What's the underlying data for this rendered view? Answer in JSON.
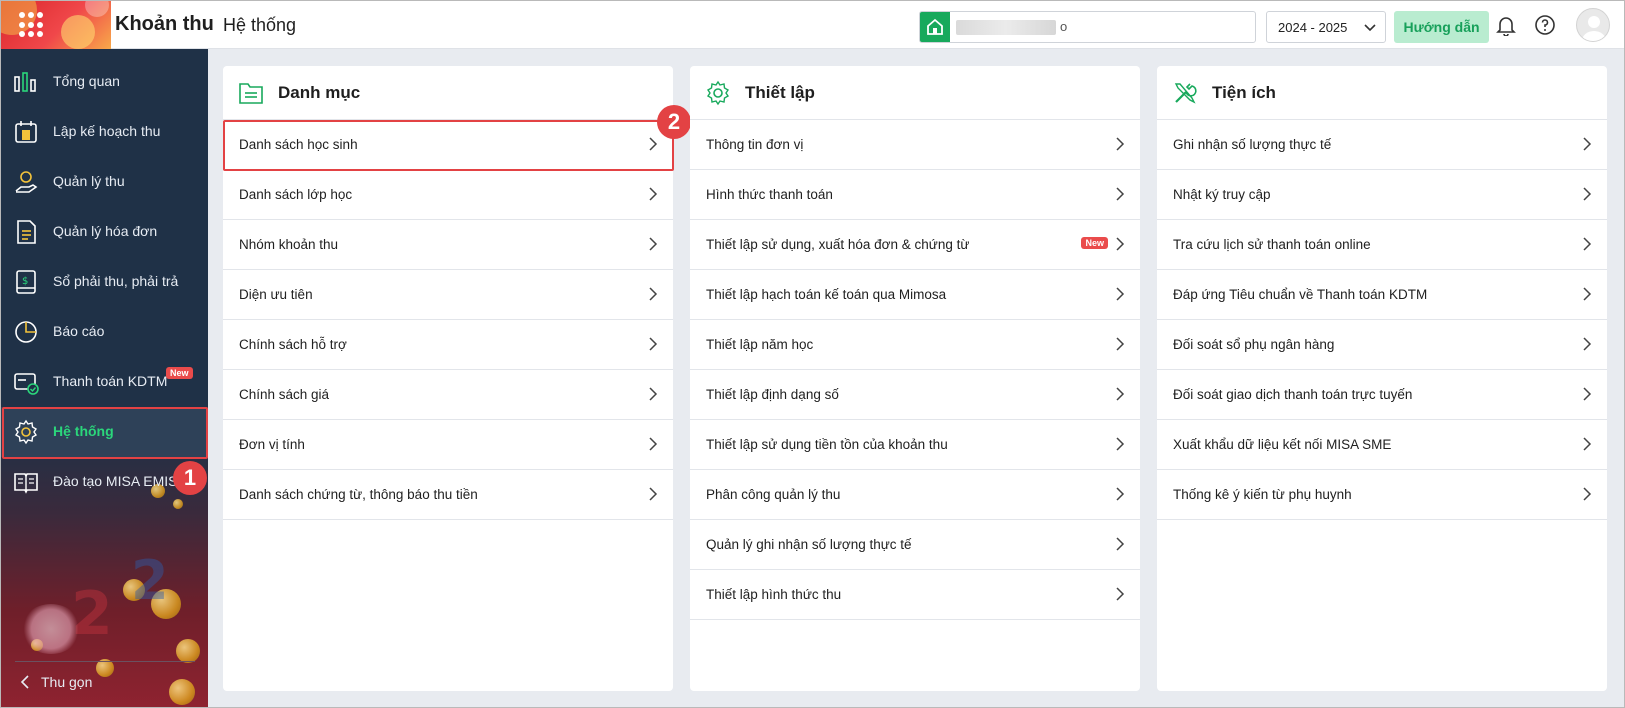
{
  "header": {
    "app_title": "Khoản thu",
    "page_title": "Hệ thống",
    "school_name_visible": "o",
    "school_year": "2024 - 2025",
    "guide_label": "Hướng dẫn",
    "brand_color": "#18a95c"
  },
  "sidebar": {
    "items": [
      {
        "label": "Tổng quan",
        "icon": "bar-chart-icon"
      },
      {
        "label": "Lập kế hoạch thu",
        "icon": "calendar-money-icon"
      },
      {
        "label": "Quản lý thu",
        "icon": "hand-coin-icon"
      },
      {
        "label": "Quản lý hóa đơn",
        "icon": "invoice-icon"
      },
      {
        "label": "Sổ phải thu, phải trả",
        "icon": "ledger-icon"
      },
      {
        "label": "Báo cáo",
        "icon": "pie-chart-icon"
      },
      {
        "label": "Thanh toán KDTM",
        "icon": "card-check-icon",
        "badge": "New"
      },
      {
        "label": "Hệ thống",
        "icon": "gear-icon",
        "active": true
      },
      {
        "label": "Đào tạo MISA EMIS",
        "icon": "book-icon"
      }
    ],
    "collapse_label": "Thu gọn",
    "active_color": "#2bd67b"
  },
  "annotations": {
    "step1": "1",
    "step2": "2",
    "color": "#e34244"
  },
  "cards": [
    {
      "title": "Danh mục",
      "icon": "folder-list-icon",
      "items": [
        {
          "label": "Danh sách học sinh"
        },
        {
          "label": "Danh sách lớp học"
        },
        {
          "label": "Nhóm khoản thu"
        },
        {
          "label": "Diện ưu tiên"
        },
        {
          "label": "Chính sách hỗ trợ"
        },
        {
          "label": "Chính sách giá"
        },
        {
          "label": "Đơn vị tính"
        },
        {
          "label": "Danh sách chứng từ, thông báo thu tiền"
        }
      ]
    },
    {
      "title": "Thiết lập",
      "icon": "settings-icon",
      "items": [
        {
          "label": "Thông tin đơn vị"
        },
        {
          "label": "Hình thức thanh toán"
        },
        {
          "label": "Thiết lập sử dụng, xuất hóa đơn & chứng từ",
          "badge": "New"
        },
        {
          "label": "Thiết lập hạch toán kế toán qua Mimosa"
        },
        {
          "label": "Thiết lập năm học"
        },
        {
          "label": "Thiết lập định dạng số"
        },
        {
          "label": "Thiết lập sử dụng tiền tồn của khoản thu"
        },
        {
          "label": "Phân công quản lý thu"
        },
        {
          "label": "Quản lý ghi nhận số lượng thực tế"
        },
        {
          "label": "Thiết lập hình thức thu"
        }
      ]
    },
    {
      "title": "Tiện ích",
      "icon": "tools-icon",
      "items": [
        {
          "label": "Ghi nhận số lượng thực tế"
        },
        {
          "label": "Nhật ký truy cập"
        },
        {
          "label": "Tra cứu lịch sử thanh toán online"
        },
        {
          "label": "Đáp ứng Tiêu chuẩn về Thanh toán KDTM"
        },
        {
          "label": "Đối soát sổ phụ ngân hàng"
        },
        {
          "label": "Đối soát giao dịch thanh toán trực tuyến"
        },
        {
          "label": "Xuất khẩu dữ liệu kết nối MISA SME"
        },
        {
          "label": "Thống kê ý kiến từ phụ huynh"
        }
      ]
    }
  ]
}
